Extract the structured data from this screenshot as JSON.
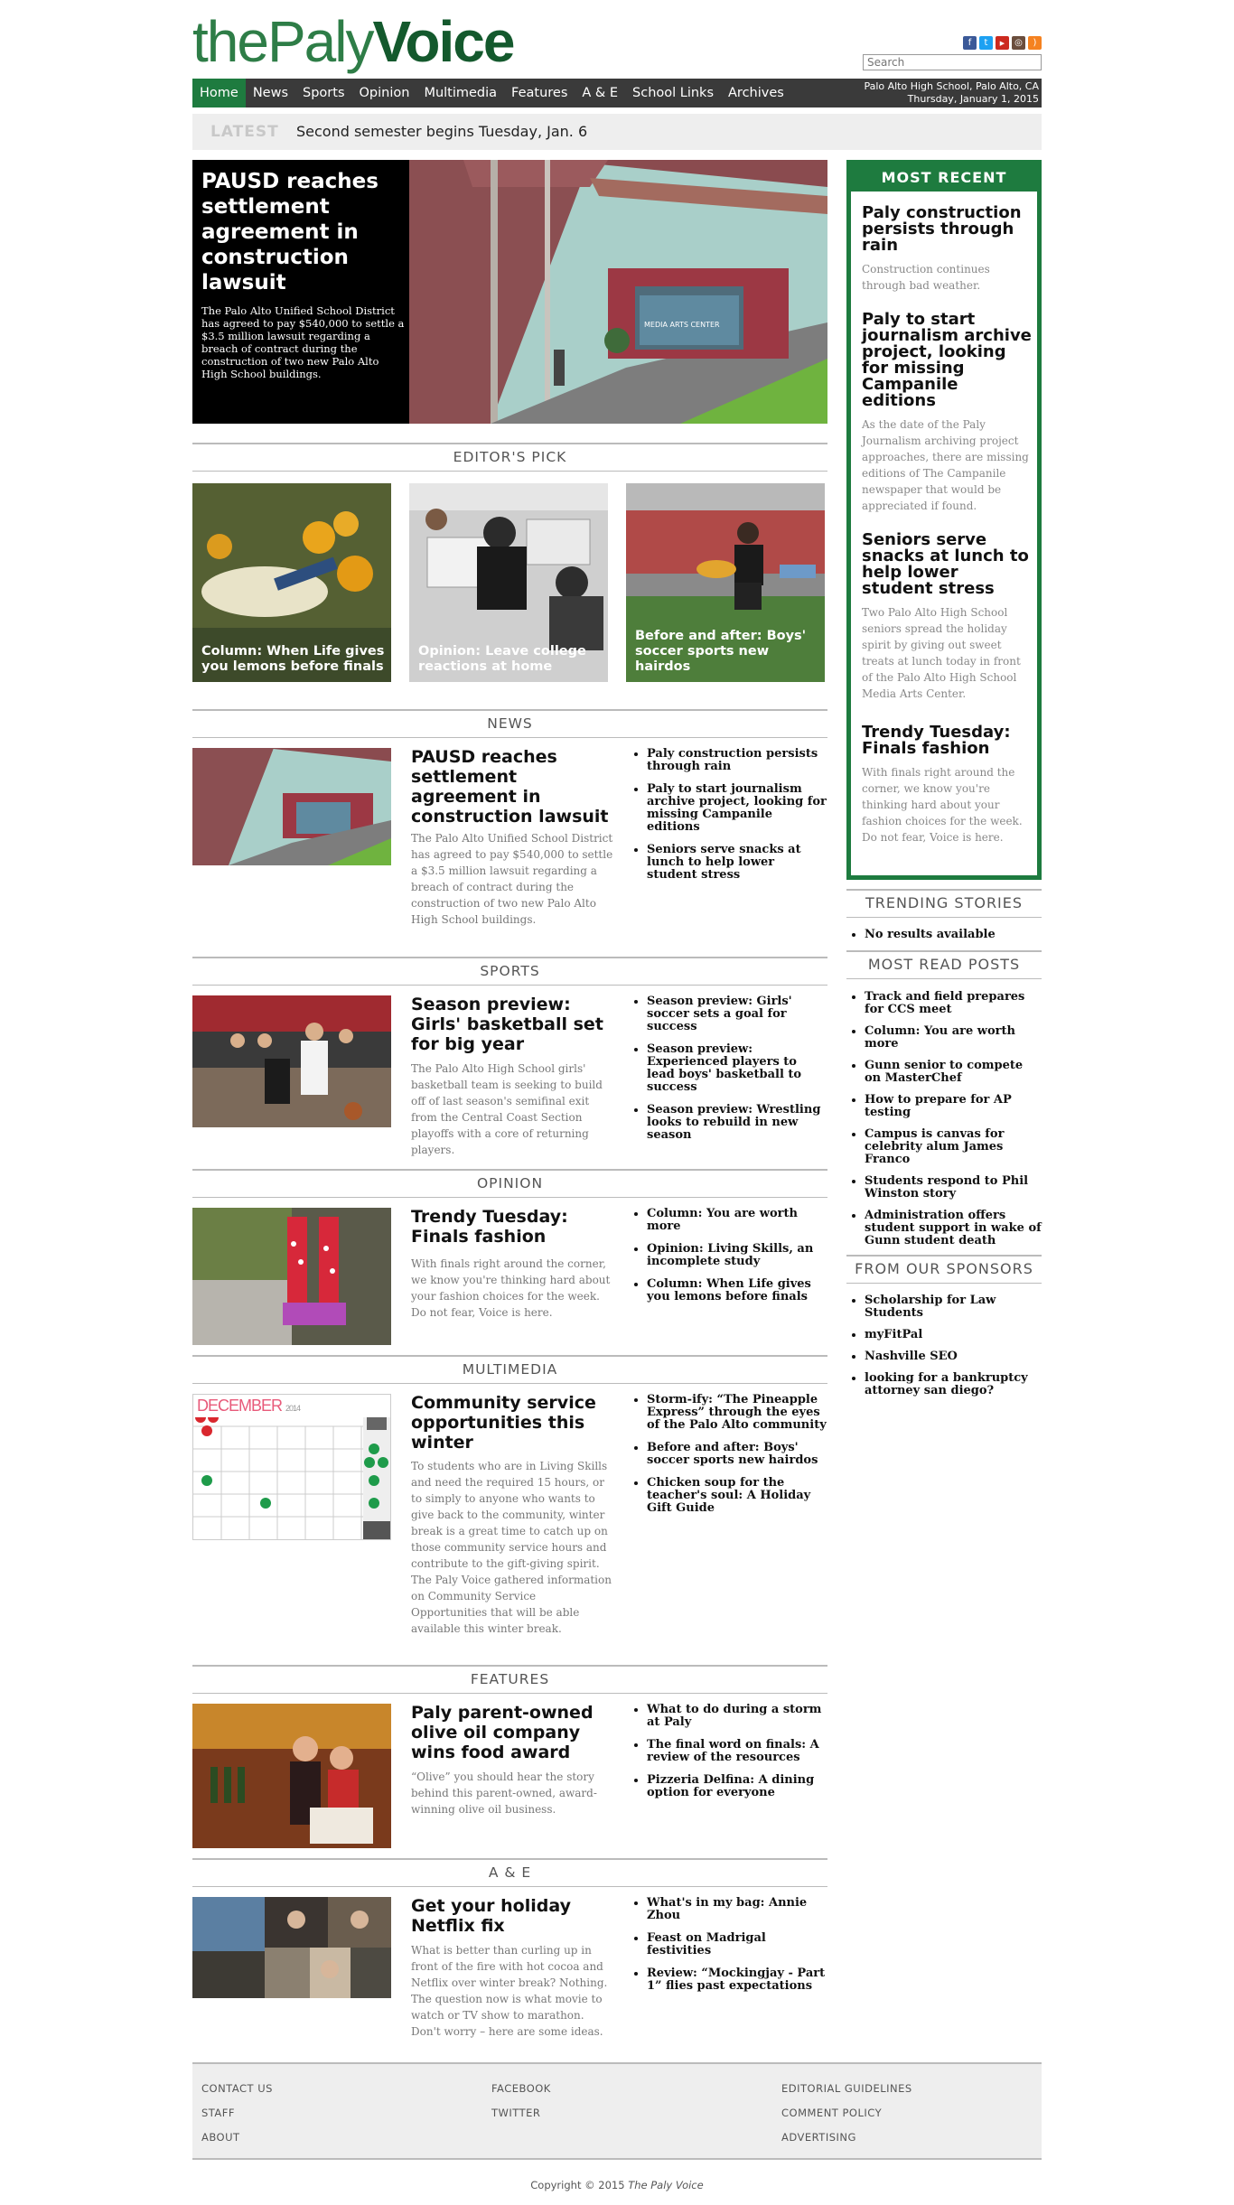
{
  "site": {
    "logo_thin": "thePaly",
    "logo_bold": "Voice"
  },
  "social": [
    {
      "icon": "facebook-icon",
      "glyph": "f",
      "color": "#3b5998"
    },
    {
      "icon": "twitter-icon",
      "glyph": "t",
      "color": "#1da1f2"
    },
    {
      "icon": "youtube-icon",
      "glyph": "▶",
      "color": "#cc2a1f"
    },
    {
      "icon": "instagram-icon",
      "glyph": "◎",
      "color": "#6b4e3d"
    },
    {
      "icon": "rss-icon",
      "glyph": ")",
      "color": "#f58220"
    }
  ],
  "search": {
    "placeholder": "Search"
  },
  "nav": {
    "items": [
      "Home",
      "News",
      "Sports",
      "Opinion",
      "Multimedia",
      "Features",
      "A & E",
      "School Links",
      "Archives"
    ],
    "location": "Palo Alto High School, Palo Alto, CA",
    "date": "Thursday, January 1, 2015"
  },
  "latest": {
    "label": "LATEST",
    "text": "Second semester begins Tuesday, Jan. 6"
  },
  "feature": {
    "title": "PAUSD reaches settlement agreement in construction lawsuit",
    "desc": "The Palo Alto Unified School District has agreed to pay $540,000 to settle a $3.5 million lawsuit regarding a breach of contract during the construction of two new Palo Alto High School buildings.",
    "sign": "MEDIA ARTS CENTER"
  },
  "editors_pick": {
    "heading": "EDITOR'S PICK",
    "items": [
      "Column: When Life gives you lemons before finals",
      "Opinion: Leave college reactions at home",
      "Before and after: Boys' soccer sports new hairdos"
    ]
  },
  "sections": [
    {
      "heading": "NEWS",
      "title": "PAUSD reaches settlement agreement in construction lawsuit",
      "desc": "The Palo Alto Unified School District has agreed to pay $540,000 to settle a $3.5 million lawsuit regarding a breach of contract during the construction of two new Palo Alto High School buildings.",
      "links": [
        "Paly construction persists through rain",
        "Paly to start journalism archive project, looking for missing Campanile editions",
        "Seniors serve snacks at lunch to help lower student stress"
      ]
    },
    {
      "heading": "SPORTS",
      "title": "Season preview: Girls' basketball set for big year",
      "desc": "The Palo Alto High School girls' basketball team is seeking to build off of last season's semifinal exit from the Central Coast Section playoffs with a core of returning players.",
      "links": [
        "Season preview: Girls' soccer sets a goal for success",
        "Season preview: Experienced players to lead boys' basketball to success",
        "Season preview: Wrestling looks to rebuild in new season"
      ]
    },
    {
      "heading": "OPINION",
      "title": "Trendy Tuesday: Finals fashion",
      "desc": "With finals right around the corner, we know you're thinking hard about your fashion choices for the week. Do not fear, Voice is here.",
      "links": [
        "Column: You are worth more",
        "Opinion: Living Skills, an incomplete study",
        "Column: When Life gives you lemons before finals"
      ]
    },
    {
      "heading": "MULTIMEDIA",
      "title": "Community service opportunities this winter",
      "desc": "To students who are in Living Skills and need the required 15 hours, or to simply to anyone who wants to give back to the community, winter break is a great time to catch up on those community service hours and contribute to the gift-giving spirit. The Paly Voice gathered information on Community Service Opportunities that will be able available this winter break.",
      "links": [
        "Storm-ify: “The Pineapple Express” through the eyes of the Palo Alto community",
        "Before and after: Boys' soccer sports new hairdos",
        "Chicken soup for the teacher's soul: A Holiday Gift Guide"
      ]
    },
    {
      "heading": "FEATURES",
      "title": "Paly parent-owned olive oil company wins food award",
      "desc": "“Olive” you should hear the story behind this parent-owned, award-winning olive oil business.",
      "links": [
        "What to do during a storm at Paly",
        "The final word on finals: A review of the resources",
        "Pizzeria Delfina: A dining option for everyone"
      ]
    },
    {
      "heading": "A & E",
      "title": "Get your holiday Netflix fix",
      "desc": "What is better than curling up in front of the fire with hot cocoa and Netflix over winter break? Nothing. The question now is what movie to watch or TV show to marathon. Don't worry – here are some ideas.",
      "links": [
        "What's in my bag: Annie Zhou",
        "Feast on Madrigal festivities",
        "Review: “Mockingjay - Part 1” flies past expectations"
      ]
    }
  ],
  "calendar": {
    "month": "DECEMBER",
    "year": "2014"
  },
  "most_recent": {
    "heading": "MOST RECENT",
    "items": [
      {
        "title": "Paly construction persists through rain",
        "desc": "Construction continues through bad weather."
      },
      {
        "title": "Paly to start journalism archive project, looking for missing Campanile editions",
        "desc": "As the date of the Paly Journalism archiving project approaches, there are missing editions of The Campanile newspaper that would be appreciated if found."
      },
      {
        "title": "Seniors serve snacks at lunch to help lower student stress",
        "desc": "Two Palo Alto High School seniors spread the holiday spirit by giving out sweet treats at lunch today in front of the Palo Alto High School Media Arts Center."
      },
      {
        "title": "Trendy Tuesday: Finals fashion",
        "desc": "With finals right around the corner, we know you're thinking hard about your fashion choices for the week. Do not fear, Voice is here."
      }
    ]
  },
  "trending": {
    "heading": "TRENDING STORIES",
    "items": [
      "No results available"
    ]
  },
  "most_read": {
    "heading": "MOST READ POSTS",
    "items": [
      "Track and field prepares for CCS meet",
      "Column: You are worth more",
      "Gunn senior to compete on MasterChef",
      "How to prepare for AP testing",
      "Campus is canvas for celebrity alum James Franco",
      "Students respond to Phil Winston story",
      "Administration offers student support in wake of Gunn student death"
    ]
  },
  "sponsors": {
    "heading": "FROM OUR SPONSORS",
    "items": [
      "Scholarship for Law Students",
      "myFitPal",
      "Nashville SEO",
      "looking for a bankruptcy attorney san diego?"
    ]
  },
  "footer": {
    "col1": [
      "CONTACT US",
      "STAFF",
      "ABOUT"
    ],
    "col2": [
      "FACEBOOK",
      "TWITTER"
    ],
    "col3": [
      "EDITORIAL GUIDELINES",
      "COMMENT POLICY",
      "ADVERTISING"
    ],
    "copyright": "Copyright © 2015",
    "copyright_name": "The Paly Voice"
  },
  "colors": {
    "brand_green": "#1e7b3f",
    "nav_dark": "#3a3a3a"
  }
}
